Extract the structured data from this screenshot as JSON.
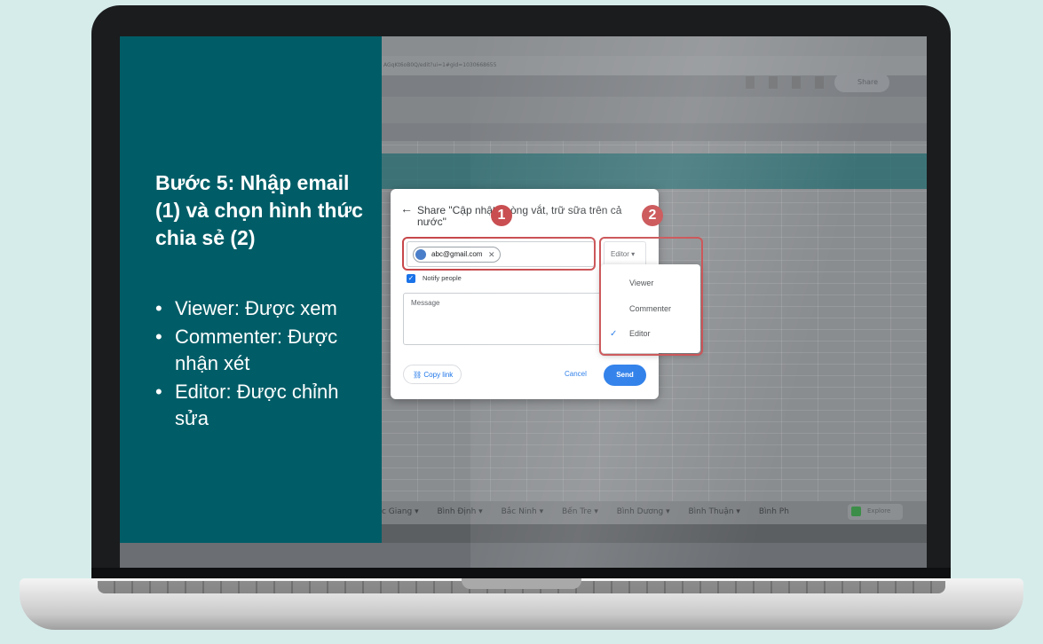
{
  "panel": {
    "heading": "Bước 5: Nhập email (1) và chọn hình thức chia sẻ (2)",
    "bullets": [
      "Viewer: Được xem",
      "Commenter: Được nhận xét",
      "Editor: Được chỉnh sửa"
    ]
  },
  "browser": {
    "url": "AGqKt6oB0Q/edit?ui=1#gid=1030668655",
    "share_label": "Share"
  },
  "sheet_tabs": [
    "c Giang ▾",
    "Bình Định ▾",
    "Bắc Ninh ▾",
    "Bến Tre ▾",
    "Bình Dương ▾",
    "Bình Thuận ▾",
    "Bình Ph"
  ],
  "explore_label": "Explore",
  "dialog": {
    "title": "Share \"Cập nhật phòng vắt, trữ sữa trên cả nước\"",
    "email_chip": "abc@gmail.com",
    "role": "Editor",
    "notify_label": "Notify people",
    "message_placeholder": "Message",
    "copy_link": "Copy link",
    "cancel": "Cancel",
    "send": "Send"
  },
  "role_menu": {
    "options": [
      "Viewer",
      "Commenter",
      "Editor"
    ],
    "selected": "Editor"
  },
  "badges": [
    "1",
    "2"
  ],
  "colors": {
    "panel_bg": "#005d67",
    "background": "#d6eceb",
    "highlight": "#c7474a",
    "primary_button": "#1a73e8"
  }
}
